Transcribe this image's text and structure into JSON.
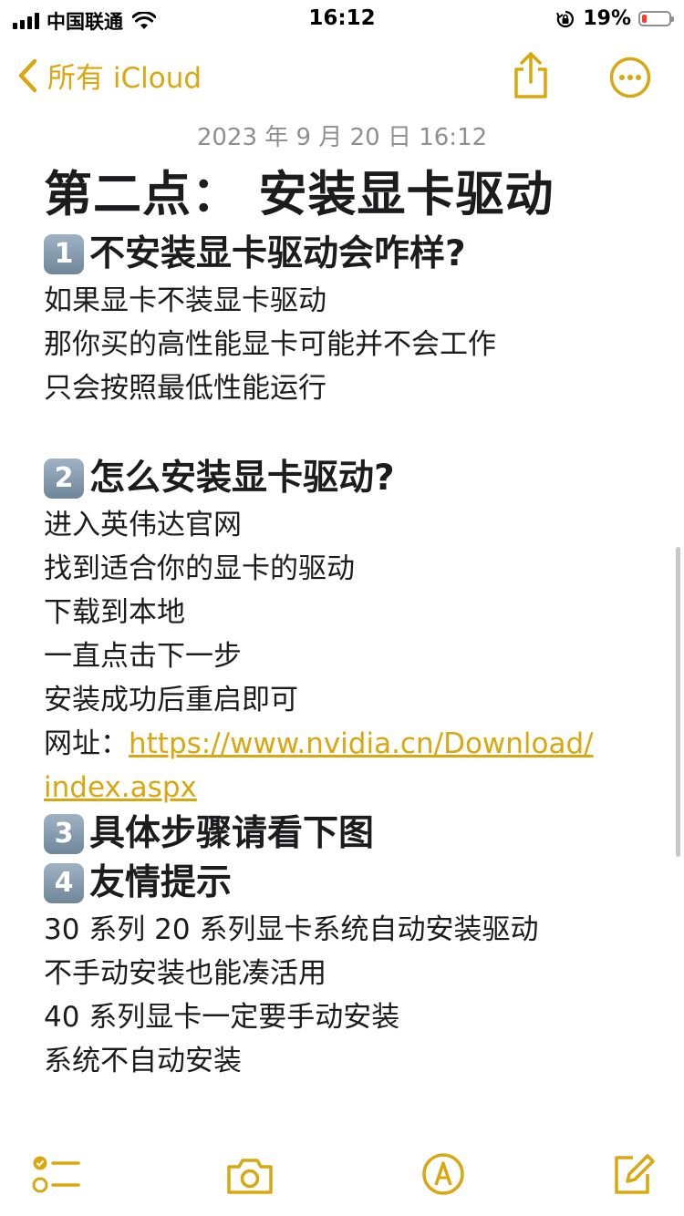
{
  "status_bar": {
    "carrier": "中国联通",
    "time": "16:12",
    "battery_percent": "19%",
    "battery_level": 0.19,
    "battery_color": "#ff3b30"
  },
  "nav": {
    "back_label": "所有 iCloud",
    "share_icon": "share-icon",
    "more_icon": "more-ellipsis-icon",
    "accent_color": "#d9a70f"
  },
  "note": {
    "date": "2023 年 9 月 20 日 16:12",
    "title": "第二点： 安装显卡驱动",
    "section1": {
      "number": "1",
      "heading": "不安装显卡驱动会咋样?",
      "lines": [
        "如果显卡不装显卡驱动",
        "那你买的高性能显卡可能并不会工作",
        "只会按照最低性能运行"
      ]
    },
    "section2": {
      "number": "2",
      "heading": "怎么安装显卡驱动?",
      "lines": [
        "进入英伟达官网",
        "找到适合你的显卡的驱动",
        "下载到本地",
        "一直点击下一步",
        "安装成功后重启即可"
      ],
      "url_label": "网址：",
      "url_line1": "https://www.nvidia.cn/Download/",
      "url_line2": "index.aspx"
    },
    "section3": {
      "number": "3",
      "heading": "具体步骤请看下图"
    },
    "section4": {
      "number": "4",
      "heading": "友情提示",
      "lines": [
        "30 系列 20 系列显卡系统自动安装驱动",
        "不手动安装也能凑活用",
        "40 系列显卡一定要手动安装",
        "系统不自动安装"
      ]
    }
  },
  "toolbar": {
    "checklist_icon": "checklist-icon",
    "camera_icon": "camera-icon",
    "markup_icon": "markup-pen-icon",
    "compose_icon": "compose-icon"
  }
}
